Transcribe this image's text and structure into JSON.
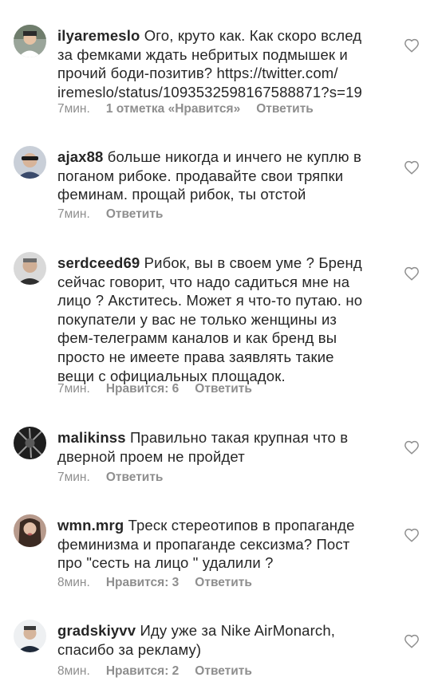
{
  "comments": [
    {
      "username": "ilyaremeslo",
      "text": "Ого, круто как. Как скоро вслед\nза фемками ждать небритых подмышек и\nпрочий боди-позитив? https://twitter.com/\niremeslo/status/1093532598167588871?s=19",
      "time": "7мин.",
      "likes": "1 отметка «Нравится»",
      "reply": "Ответить"
    },
    {
      "username": "ajax88",
      "text": "больше никогда и инчего не куплю в\nпоганом рибоке. продавайте свои тряпки\nфеминам. прощай рибок, ты отстой",
      "time": "7мин.",
      "likes": "",
      "reply": "Ответить"
    },
    {
      "username": "serdceed69",
      "text": "Рибок, вы в своем уме ? Бренд\nсейчас говорит, что надо садиться мне на\nлицо ? Акститесь. Может я что-то путаю. но\nпокупатели у вас не только женщины из\nфем-телеграмм каналов и как бренд вы\nпросто не имеете права заявлять такие\nвещи с официальных площадок.",
      "time": "7мин.",
      "likes": "Нравится: 6",
      "reply": "Ответить"
    },
    {
      "username": "malikinss",
      "text": "Правильно такая крупная что в\nдверной проем не пройдет",
      "time": "7мин.",
      "likes": "",
      "reply": "Ответить"
    },
    {
      "username": "wmn.mrg",
      "text": "Треск стереотипов в пропаганде\nфеминизма и пропаганде сексизма? Пост\nпро \"сесть на лицо \" удалили ?",
      "time": "8мин.",
      "likes": "Нравится: 3",
      "reply": "Ответить"
    },
    {
      "username": "gradskiyvv",
      "text": "Иду уже за Nike AirMonarch,\nспасибо за рекламу)",
      "time": "8мин.",
      "likes": "Нравится: 2",
      "reply": "Ответить"
    }
  ],
  "icons": {
    "like": "heart-outline-icon"
  },
  "colors": {
    "text": "#262626",
    "meta": "#8e8e8e",
    "background": "#ffffff"
  }
}
